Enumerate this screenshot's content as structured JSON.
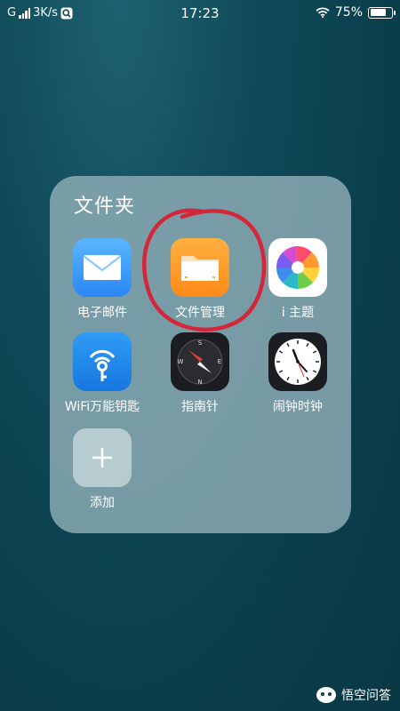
{
  "status_bar": {
    "carrier": "G",
    "speed": "3K/s",
    "time": "17:23",
    "battery": "75%",
    "battery_level": 0.75
  },
  "folder": {
    "title": "文件夹",
    "apps": [
      {
        "label": "电子邮件",
        "icon": "mail-icon"
      },
      {
        "label": "文件管理",
        "icon": "folder-icon"
      },
      {
        "label": "i 主题",
        "icon": "pinwheel-icon"
      },
      {
        "label": "WiFi万能钥匙",
        "icon": "wifi-key-icon"
      },
      {
        "label": "指南针",
        "icon": "compass-icon"
      },
      {
        "label": "闹钟时钟",
        "icon": "clock-icon"
      },
      {
        "label": "添加",
        "icon": "plus-icon"
      }
    ]
  },
  "annotation": {
    "color": "#d4263a",
    "target": "文件管理"
  },
  "watermark": {
    "text": "悟空问答"
  },
  "colors": {
    "folder_bg": "#96b4bc",
    "mail": "#2a86f2",
    "files": "#ff8a18",
    "wifi": "#1777e0"
  }
}
